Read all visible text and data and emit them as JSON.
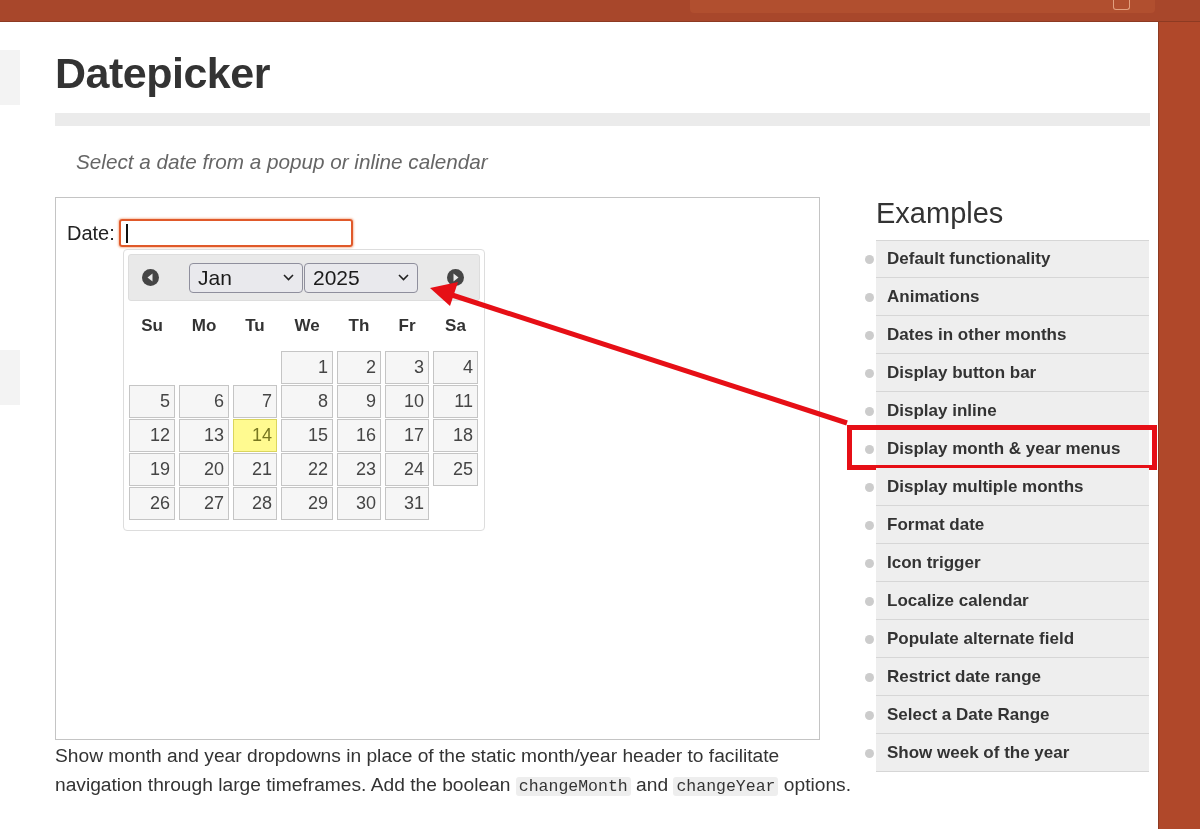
{
  "page": {
    "title": "Datepicker",
    "subtitle": "Select a date from a popup or inline calendar"
  },
  "demo": {
    "label": "Date:",
    "focused": true,
    "datepicker": {
      "month": "Jan",
      "year": "2025",
      "weekdays": [
        "Su",
        "Mo",
        "Tu",
        "We",
        "Th",
        "Fr",
        "Sa"
      ],
      "weeks": [
        [
          {
            "kind": "blank"
          },
          {
            "kind": "blank"
          },
          {
            "kind": "blank"
          },
          {
            "kind": "day",
            "day": "1",
            "today": false
          },
          {
            "kind": "day",
            "day": "2",
            "today": false
          },
          {
            "kind": "day",
            "day": "3",
            "today": false
          },
          {
            "kind": "day",
            "day": "4",
            "today": false
          }
        ],
        [
          {
            "kind": "day",
            "day": "5",
            "today": false
          },
          {
            "kind": "day",
            "day": "6",
            "today": false
          },
          {
            "kind": "day",
            "day": "7",
            "today": false
          },
          {
            "kind": "day",
            "day": "8",
            "today": false
          },
          {
            "kind": "day",
            "day": "9",
            "today": false
          },
          {
            "kind": "day",
            "day": "10",
            "today": false
          },
          {
            "kind": "day",
            "day": "11",
            "today": false
          }
        ],
        [
          {
            "kind": "day",
            "day": "12",
            "today": false
          },
          {
            "kind": "day",
            "day": "13",
            "today": false
          },
          {
            "kind": "day",
            "day": "14",
            "today": true
          },
          {
            "kind": "day",
            "day": "15",
            "today": false
          },
          {
            "kind": "day",
            "day": "16",
            "today": false
          },
          {
            "kind": "day",
            "day": "17",
            "today": false
          },
          {
            "kind": "day",
            "day": "18",
            "today": false
          }
        ],
        [
          {
            "kind": "day",
            "day": "19",
            "today": false
          },
          {
            "kind": "day",
            "day": "20",
            "today": false
          },
          {
            "kind": "day",
            "day": "21",
            "today": false
          },
          {
            "kind": "day",
            "day": "22",
            "today": false
          },
          {
            "kind": "day",
            "day": "23",
            "today": false
          },
          {
            "kind": "day",
            "day": "24",
            "today": false
          },
          {
            "kind": "day",
            "day": "25",
            "today": false
          }
        ],
        [
          {
            "kind": "day",
            "day": "26",
            "today": false
          },
          {
            "kind": "day",
            "day": "27",
            "today": false
          },
          {
            "kind": "day",
            "day": "28",
            "today": false
          },
          {
            "kind": "day",
            "day": "29",
            "today": false
          },
          {
            "kind": "day",
            "day": "30",
            "today": false
          },
          {
            "kind": "day",
            "day": "31",
            "today": false
          },
          {
            "kind": "blank"
          }
        ]
      ]
    }
  },
  "examples": {
    "heading": "Examples",
    "items": [
      {
        "label": "Default functionality",
        "highlighted": false
      },
      {
        "label": "Animations",
        "highlighted": false
      },
      {
        "label": "Dates in other months",
        "highlighted": false
      },
      {
        "label": "Display button bar",
        "highlighted": false
      },
      {
        "label": "Display inline",
        "highlighted": false
      },
      {
        "label": "Display month & year menus",
        "highlighted": true
      },
      {
        "label": "Display multiple months",
        "highlighted": false
      },
      {
        "label": "Format date",
        "highlighted": false
      },
      {
        "label": "Icon trigger",
        "highlighted": false
      },
      {
        "label": "Localize calendar",
        "highlighted": false
      },
      {
        "label": "Populate alternate field",
        "highlighted": false
      },
      {
        "label": "Restrict date range",
        "highlighted": false
      },
      {
        "label": "Select a Date Range",
        "highlighted": false
      },
      {
        "label": "Show week of the year",
        "highlighted": false
      }
    ]
  },
  "description": [
    {
      "kind": "text",
      "text": "Show month and year dropdowns in place of the static month/year header to facilitate navigation through large timeframes. Add the boolean "
    },
    {
      "kind": "code",
      "text": "changeMonth"
    },
    {
      "kind": "text",
      "text": " and "
    },
    {
      "kind": "code",
      "text": "changeYear"
    },
    {
      "kind": "text",
      "text": " options."
    }
  ]
}
